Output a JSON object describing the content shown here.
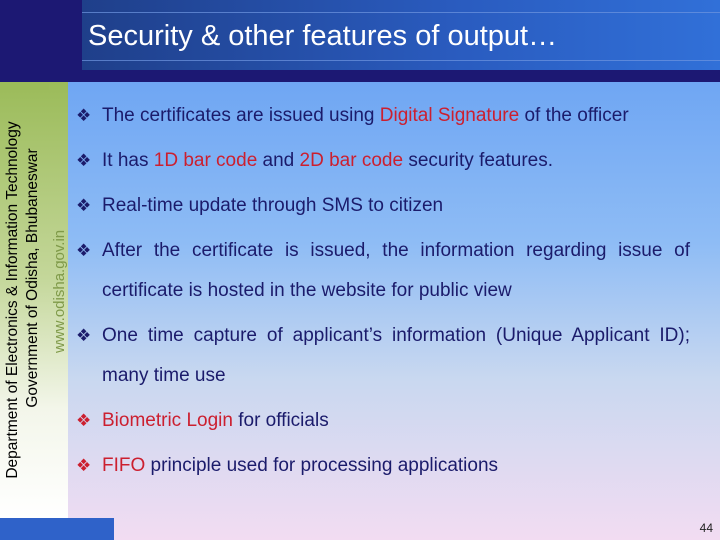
{
  "slide": {
    "title": "Security & other features of output…",
    "sidebar": {
      "line1": "Department of Electronics & Information Technology",
      "line2": "Government of Odisha, Bhubaneswar",
      "url": "www.odisha.gov.in"
    },
    "bullet_icon": "diamond-four-dots-icon",
    "bullets": [
      {
        "parts": [
          {
            "t": "The  certificates  are  issued  using  "
          },
          {
            "t": "Digital  Signature",
            "hl": true
          },
          {
            "t": "  of  the officer"
          }
        ]
      },
      {
        "parts": [
          {
            "t": "It has "
          },
          {
            "t": "1D bar code",
            "hl": true
          },
          {
            "t": " and "
          },
          {
            "t": "2D bar code",
            "hl": true
          },
          {
            "t": " security features."
          }
        ]
      },
      {
        "parts": [
          {
            "t": "Real-time update through SMS to citizen"
          }
        ]
      },
      {
        "parts": [
          {
            "t": "After the certificate is issued,  the information regarding issue of certificate  is hosted in the website for public view"
          }
        ]
      },
      {
        "parts": [
          {
            "t": "One   time   capture   of   applicant’s   information   (Unique Applicant ID); many time use"
          }
        ]
      },
      {
        "parts": [
          {
            "t": "Biometric Login",
            "hl": true
          },
          {
            "t": " for officials"
          }
        ],
        "red_icon": true
      },
      {
        "parts": [
          {
            "t": "FIFO",
            "hl": true
          },
          {
            "t": " principle used for processing applications"
          }
        ],
        "red_icon": true
      }
    ],
    "page_number": "44",
    "colors": {
      "accent_red": "#cc1f2f",
      "text_navy": "#1b1b6b",
      "title_bar": "#2a5cc0",
      "green": "#9bbb59"
    }
  }
}
